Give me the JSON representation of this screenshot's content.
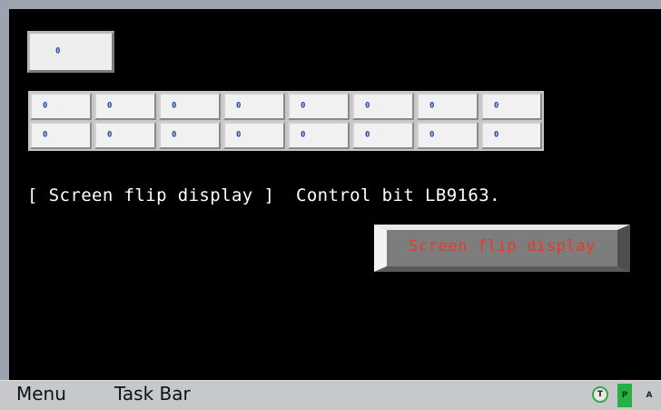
{
  "screen": {
    "top_value": "0",
    "grid_values": [
      [
        "0",
        "0",
        "0",
        "0",
        "0",
        "0",
        "0",
        "0"
      ],
      [
        "0",
        "0",
        "0",
        "0",
        "0",
        "0",
        "0",
        "0"
      ]
    ],
    "info_text": "[ Screen flip display ]  Control bit LB9163."
  },
  "flip_button": {
    "label": "Screen flip display"
  },
  "taskbar": {
    "menu_label": "Menu",
    "taskbar_label": "Task Bar",
    "indicators": {
      "t": "T",
      "p": "P",
      "a": "A"
    }
  },
  "colors": {
    "screen_bg": "#000000",
    "value_text": "#1b3fa8",
    "button_text": "#e8392b",
    "indicator_green": "#27b043"
  }
}
